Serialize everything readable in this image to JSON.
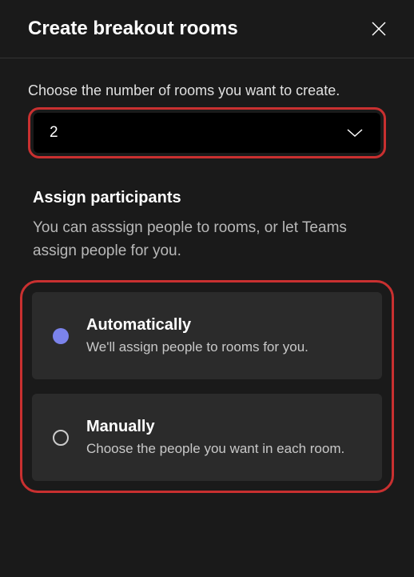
{
  "header": {
    "title": "Create breakout rooms"
  },
  "rooms": {
    "instruction": "Choose the number of rooms you want to create.",
    "selected": "2"
  },
  "assign": {
    "title": "Assign participants",
    "description": "You can asssign people to rooms, or let Teams assign people for you.",
    "options": [
      {
        "title": "Automatically",
        "description": "We'll assign people to rooms for you.",
        "selected": true
      },
      {
        "title": "Manually",
        "description": "Choose the people you want in each room.",
        "selected": false
      }
    ]
  }
}
